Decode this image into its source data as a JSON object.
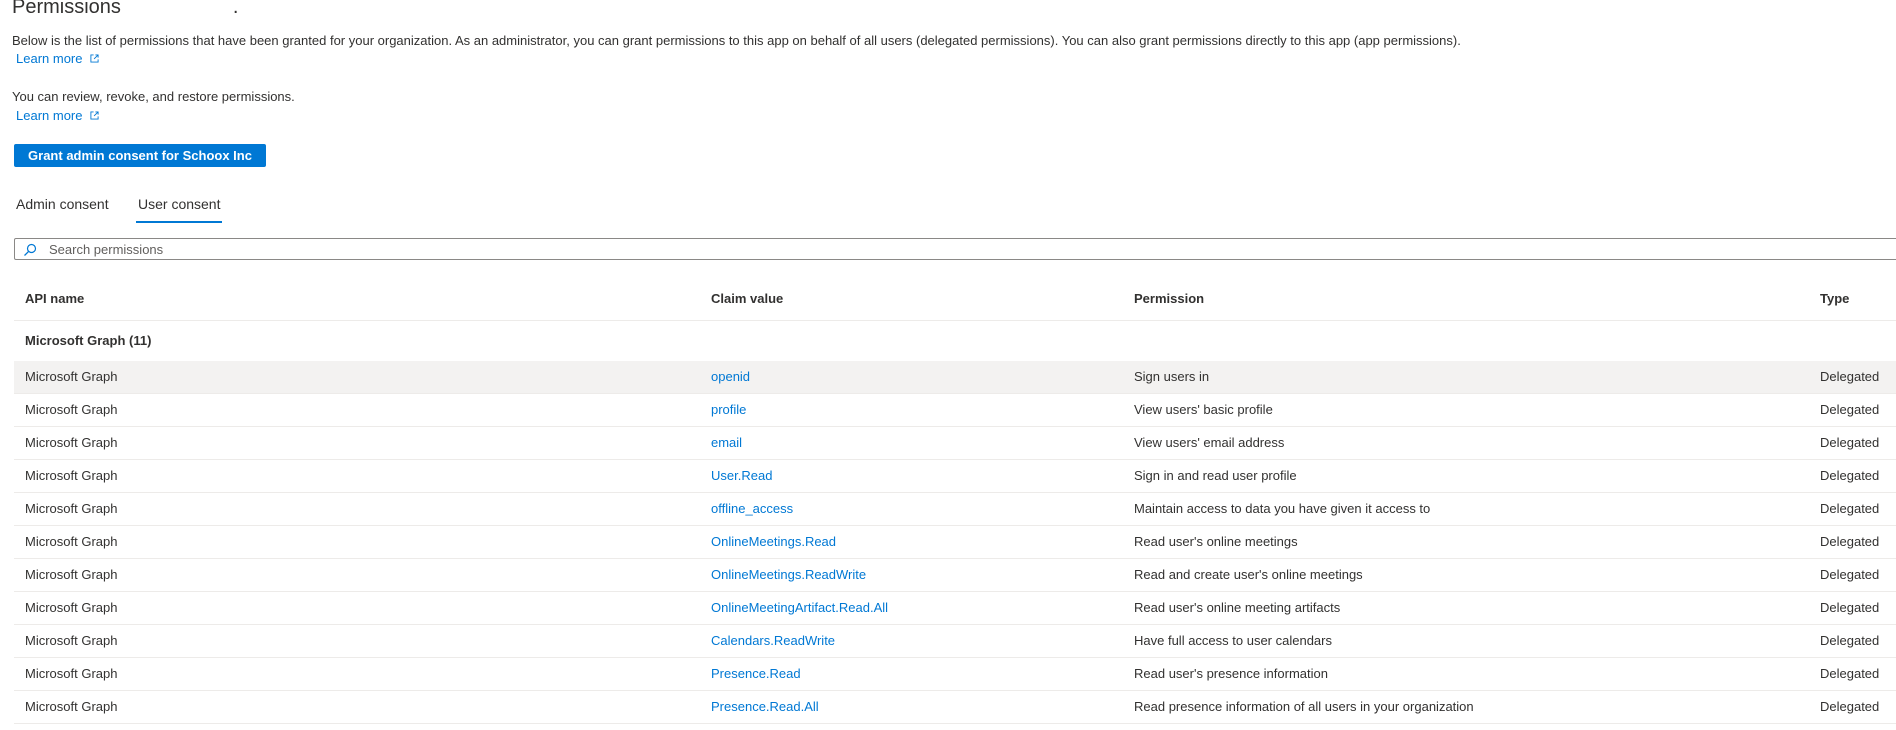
{
  "header": {
    "title": "Permissions",
    "title_suffix": "."
  },
  "intro": {
    "description": "Below is the list of permissions that have been granted for your organization. As an administrator, you can grant permissions to this app on behalf of all users (delegated permissions). You can also grant permissions directly to this app (app permissions).",
    "learn_more_1": "Learn more",
    "review_text": "You can review, revoke, and restore permissions.",
    "learn_more_2": "Learn more"
  },
  "actions": {
    "grant_label": "Grant admin consent for Schoox Inc"
  },
  "tabs": [
    {
      "label": "Admin consent",
      "active": false
    },
    {
      "label": "User consent",
      "active": true
    }
  ],
  "search": {
    "placeholder": "Search permissions",
    "value": ""
  },
  "table": {
    "columns": [
      "API name",
      "Claim value",
      "Permission",
      "Type"
    ],
    "group_label": "Microsoft Graph (11)",
    "rows": [
      {
        "api": "Microsoft Graph",
        "claim": "openid",
        "permission": "Sign users in",
        "type": "Delegated"
      },
      {
        "api": "Microsoft Graph",
        "claim": "profile",
        "permission": "View users' basic profile",
        "type": "Delegated"
      },
      {
        "api": "Microsoft Graph",
        "claim": "email",
        "permission": "View users' email address",
        "type": "Delegated"
      },
      {
        "api": "Microsoft Graph",
        "claim": "User.Read",
        "permission": "Sign in and read user profile",
        "type": "Delegated"
      },
      {
        "api": "Microsoft Graph",
        "claim": "offline_access",
        "permission": "Maintain access to data you have given it access to",
        "type": "Delegated"
      },
      {
        "api": "Microsoft Graph",
        "claim": "OnlineMeetings.Read",
        "permission": "Read user's online meetings",
        "type": "Delegated"
      },
      {
        "api": "Microsoft Graph",
        "claim": "OnlineMeetings.ReadWrite",
        "permission": "Read and create user's online meetings",
        "type": "Delegated"
      },
      {
        "api": "Microsoft Graph",
        "claim": "OnlineMeetingArtifact.Read.All",
        "permission": "Read user's online meeting artifacts",
        "type": "Delegated"
      },
      {
        "api": "Microsoft Graph",
        "claim": "Calendars.ReadWrite",
        "permission": "Have full access to user calendars",
        "type": "Delegated"
      },
      {
        "api": "Microsoft Graph",
        "claim": "Presence.Read",
        "permission": "Read user's presence information",
        "type": "Delegated"
      },
      {
        "api": "Microsoft Graph",
        "claim": "Presence.Read.All",
        "permission": "Read presence information of all users in your organization",
        "type": "Delegated"
      }
    ]
  },
  "colors": {
    "accent": "#0078d4",
    "text": "#323130",
    "selected_row": "#f3f2f1",
    "divider": "#edebe9"
  },
  "icons": {
    "search": "search-icon",
    "external_link": "external-link-icon"
  }
}
